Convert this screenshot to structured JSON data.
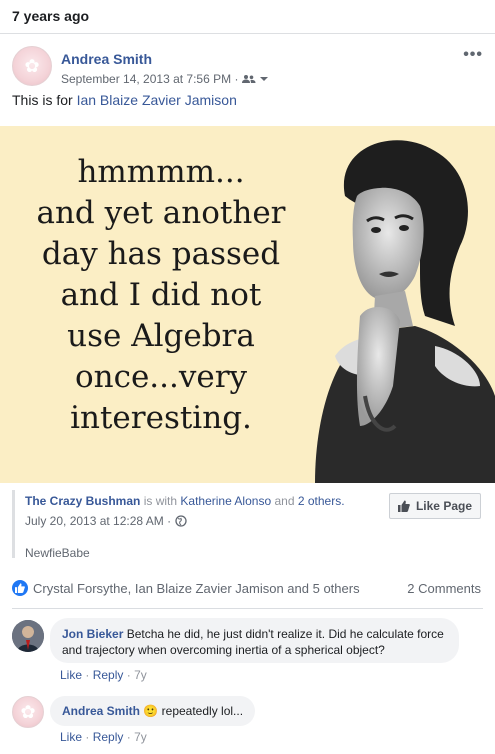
{
  "memory": {
    "label": "7 years ago"
  },
  "post": {
    "author": "Andrea Smith",
    "timestamp": "September 14, 2013 at 7:56 PM ·",
    "more_label": "•••",
    "text_prefix": "This is for ",
    "tagged_person": "Ian Blaize Zavier Jamison"
  },
  "meme": {
    "lines": [
      "hmmmm...",
      "and yet another",
      "day has passed",
      "and I did not",
      "use Algebra",
      "once...very",
      "interesting."
    ]
  },
  "shared": {
    "page_name": "The Crazy Bushman",
    "with_text": "is with",
    "tagged": "Katherine Alonso",
    "and_text": "and",
    "others": "2 others.",
    "date": "July 20, 2013 at 12:28 AM ·",
    "caption": "NewfieBabe",
    "like_page_label": "Like Page"
  },
  "reactions": {
    "names": "Crystal Forsythe, Ian Blaize Zavier Jamison and 5 others",
    "comments": "2 Comments"
  },
  "comments": [
    {
      "name": "Jon Bieker",
      "text": " Betcha he did, he just didn't realize it. Did he calculate force and trajectory when overcoming inertia of a spherical object?",
      "like": "Like",
      "reply": "Reply",
      "sep": "·",
      "age": "7y"
    },
    {
      "name": "Andrea Smith",
      "emoji": "🙂",
      "text": "repeatedly lol...",
      "like": "Like",
      "reply": "Reply",
      "sep": "·",
      "age": "7y"
    }
  ],
  "colors": {
    "link": "#385898",
    "accent": "#2078f4",
    "meme_bg": "#fbeec5"
  }
}
